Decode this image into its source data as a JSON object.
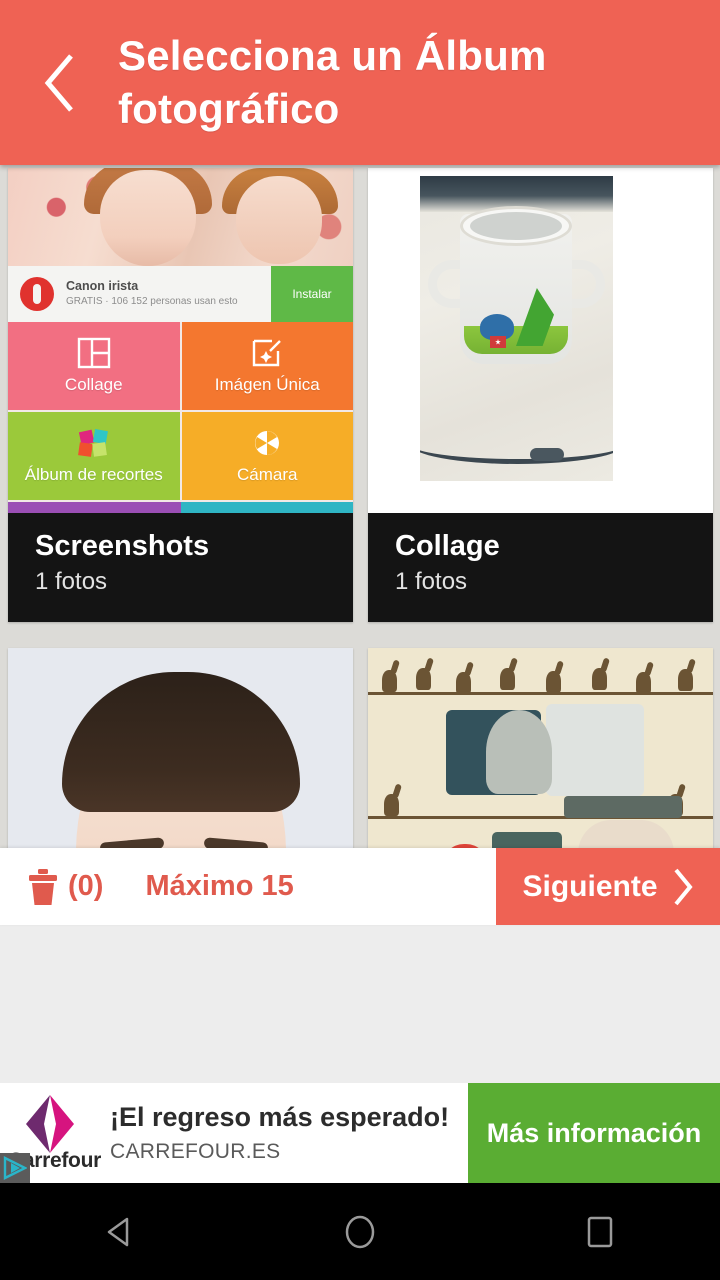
{
  "header": {
    "title": "Selecciona un Álbum fotográfico",
    "back_icon": "chevron-left-icon",
    "bg_color": "#EF6254"
  },
  "albums": [
    {
      "name": "Screenshots",
      "count_label": "1 fotos",
      "thumbnail": "app-screenshot-collage-tiles"
    },
    {
      "name": "Collage",
      "count_label": "1 fotos",
      "thumbnail": "white-mug-photo"
    },
    {
      "name": "",
      "count_label": "",
      "thumbnail": "portrait-face-photo"
    },
    {
      "name": "",
      "count_label": "",
      "thumbnail": "cats-wallpaper-collage"
    }
  ],
  "screenshot_thumb": {
    "ad_title": "Canon irista",
    "ad_subtitle": "GRATIS · 106 152 personas usan esto",
    "install_label": "Instalar",
    "tiles": [
      {
        "label": "Collage",
        "color": "#F26F82",
        "icon": "collage-grid-icon"
      },
      {
        "label": "Imágen Única",
        "color": "#F4772F",
        "icon": "single-image-edit-icon"
      },
      {
        "label": "Álbum de recortes",
        "color": "#9BC93A",
        "icon": "scrapbook-icon"
      },
      {
        "label": "Cámara",
        "color": "#F6AD27",
        "icon": "camera-shutter-icon"
      }
    ]
  },
  "action_bar": {
    "trash_icon": "trash-icon",
    "selected_count": "(0)",
    "max_label": "Máximo 15",
    "next_label": "Siguiente",
    "next_icon": "chevron-right-icon",
    "accent_color": "#EF6254"
  },
  "ad": {
    "advertiser": "Carrefour",
    "headline": "¡El regreso más esperado!",
    "url": "CARREFOUR.ES",
    "cta_label": "Más información",
    "cta_color": "#5AAD33",
    "adchoices_icon": "adchoices-icon"
  },
  "navbar": {
    "back": "back-triangle-icon",
    "home": "home-circle-icon",
    "recents": "recents-square-icon"
  }
}
